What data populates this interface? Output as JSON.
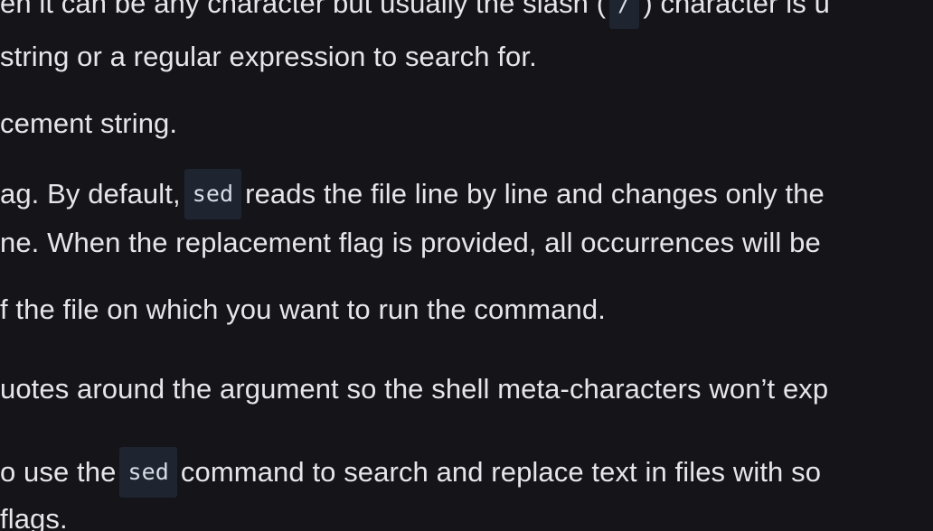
{
  "doc": {
    "line0": {
      "before": "en it can be any character but usually the slash (",
      "code": "/",
      "after": ") character is u"
    },
    "line1": "string or a regular expression to search for.",
    "line2": "cement string.",
    "line3": {
      "before": "ag. By default,",
      "code": "sed",
      "after": "reads the file line by line and changes only the"
    },
    "line4": "ne. When the replacement flag is provided, all occurrences will be",
    "line5": "f the file on which you want to run the command.",
    "line6": "uotes around the argument so the shell meta-characters won’t exp",
    "line7": {
      "before": "o use the",
      "code": "sed",
      "after": "command to search and replace text in files with so"
    },
    "line8": "flags."
  }
}
